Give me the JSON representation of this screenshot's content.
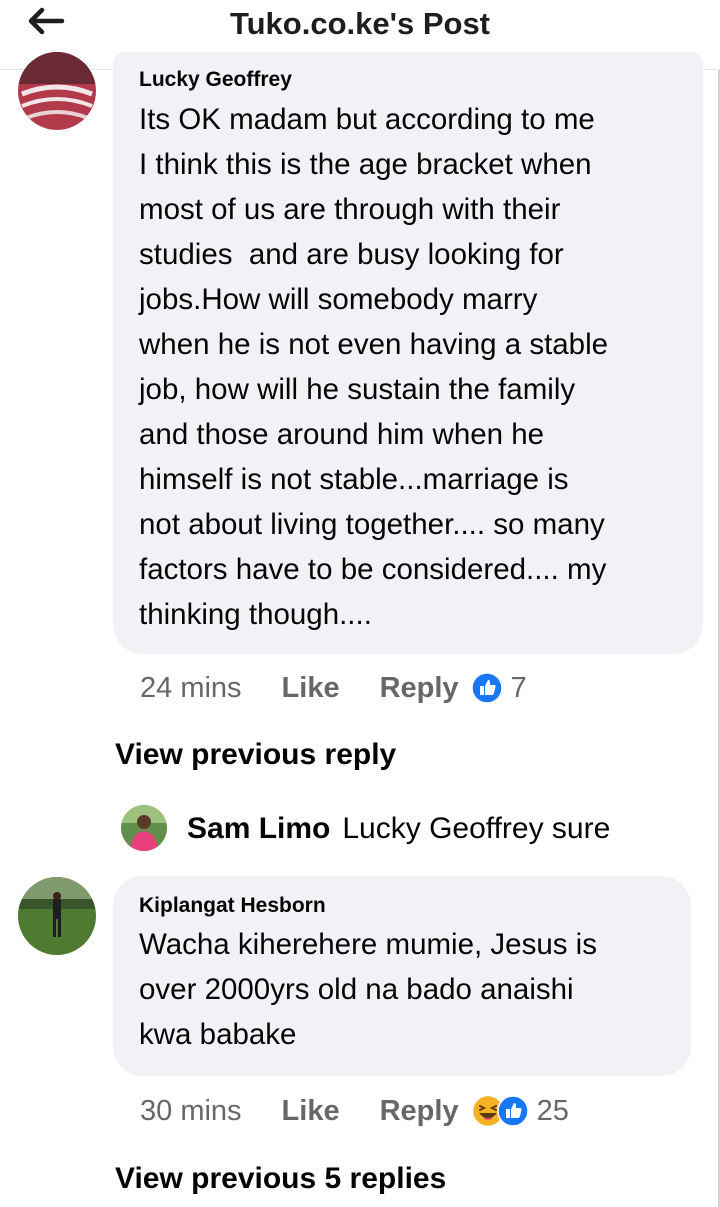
{
  "header": {
    "title": "Tuko.co.ke's Post",
    "back_icon": "arrow-left-icon"
  },
  "comments": [
    {
      "author": "Lucky Geoffrey",
      "text": "Its OK madam but according to me\nI think this is the age bracket when\nmost of us are through with their\nstudies  and are busy looking for\njobs.How will somebody marry\nwhen he is not even having a stable\njob, how will he sustain the family\nand those around him when he\nhimself is not stable...marriage is\nnot about living together.... so many\nfactors have to be considered.... my\nthinking though....",
      "time": "24 mins",
      "like_label": "Like",
      "reply_label": "Reply",
      "reaction_icons": [
        "like-reaction-icon"
      ],
      "reaction_count": "7",
      "view_previous": "View previous reply"
    },
    {
      "author": "Kiplangat Hesborn",
      "text": "Wacha kiherehere mumie, Jesus is\nover 2000yrs old na bado anaishi\nkwa babake",
      "time": "30 mins",
      "like_label": "Like",
      "reply_label": "Reply",
      "reaction_icons": [
        "haha-reaction-icon",
        "like-reaction-icon"
      ],
      "reaction_count": "25",
      "view_previous": "View previous 5 replies"
    }
  ],
  "reply": {
    "author": "Sam Limo",
    "text": "Lucky Geoffrey sure"
  },
  "colors": {
    "bubble": "#f0f2f5",
    "meta": "#65676b",
    "like_blue": "#1877f2",
    "haha_yellow": "#f7b125"
  }
}
